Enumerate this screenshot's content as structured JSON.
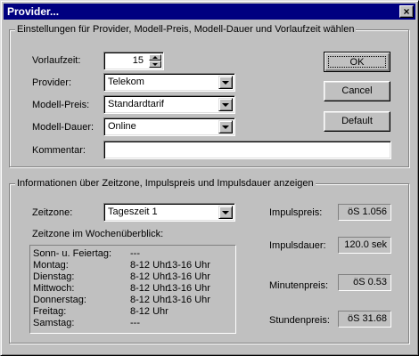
{
  "window": {
    "title": "Provider...",
    "close_glyph": "×"
  },
  "settings_group": {
    "label": "Einstellungen für Provider, Modell-Preis, Modell-Dauer und Vorlaufzeit wählen",
    "vorlaufzeit_label": "Vorlaufzeit:",
    "vorlaufzeit_value": "15",
    "provider_label": "Provider:",
    "provider_value": "Telekom",
    "modellpreis_label": "Modell-Preis:",
    "modellpreis_value": "Standardtarif",
    "modelldauer_label": "Modell-Dauer:",
    "modelldauer_value": "Online",
    "kommentar_label": "Kommentar:",
    "kommentar_value": ""
  },
  "buttons": {
    "ok": "OK",
    "cancel": "Cancel",
    "default": "Default"
  },
  "info_group": {
    "label": "Informationen über Zeitzone, Impulspreis und Impulsdauer anzeigen",
    "zeitzone_label": "Zeitzone:",
    "zeitzone_value": "Tageszeit 1",
    "week_label": "Zeitzone im Wochenüberblick:",
    "week": [
      {
        "day": "Sonn- u. Feiertag:",
        "t1": "---",
        "t2": ""
      },
      {
        "day": "Montag:",
        "t1": "8-12 Uhr",
        "t2": "13-16 Uhr"
      },
      {
        "day": "Dienstag:",
        "t1": "8-12 Uhr",
        "t2": "13-16 Uhr"
      },
      {
        "day": "Mittwoch:",
        "t1": "8-12 Uhr",
        "t2": "13-16 Uhr"
      },
      {
        "day": "Donnerstag:",
        "t1": "8-12 Uhr",
        "t2": "13-16 Uhr"
      },
      {
        "day": "Freitag:",
        "t1": "8-12 Uhr",
        "t2": ""
      },
      {
        "day": "Samstag:",
        "t1": "---",
        "t2": ""
      }
    ],
    "impulspreis_label": "Impulspreis:",
    "impulspreis_value": "öS 1.056",
    "impulsdauer_label": "Impulsdauer:",
    "impulsdauer_value": "120.0 sek",
    "minutenpreis_label": "Minutenpreis:",
    "minutenpreis_value": "öS 0.53",
    "stundenpreis_label": "Stundenpreis:",
    "stundenpreis_value": "öS 31.68"
  },
  "colors": {
    "titlebar": "#000080",
    "face": "#c0c0c0"
  }
}
